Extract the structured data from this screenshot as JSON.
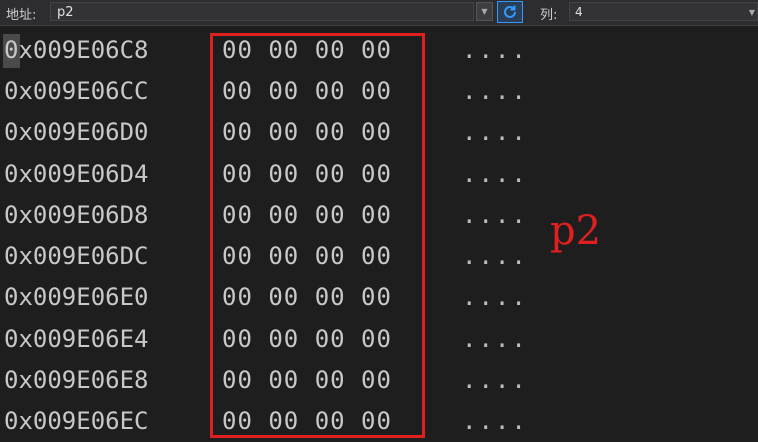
{
  "toolbar": {
    "address_label": "地址:",
    "address_value": "p2",
    "column_label": "列:",
    "column_value": "4"
  },
  "memory": {
    "rows": [
      {
        "address": "0x009E06C8",
        "bytes": "00 00 00 00",
        "ascii": "...."
      },
      {
        "address": "0x009E06CC",
        "bytes": "00 00 00 00",
        "ascii": "...."
      },
      {
        "address": "0x009E06D0",
        "bytes": "00 00 00 00",
        "ascii": "...."
      },
      {
        "address": "0x009E06D4",
        "bytes": "00 00 00 00",
        "ascii": "...."
      },
      {
        "address": "0x009E06D8",
        "bytes": "00 00 00 00",
        "ascii": "...."
      },
      {
        "address": "0x009E06DC",
        "bytes": "00 00 00 00",
        "ascii": "...."
      },
      {
        "address": "0x009E06E0",
        "bytes": "00 00 00 00",
        "ascii": "...."
      },
      {
        "address": "0x009E06E4",
        "bytes": "00 00 00 00",
        "ascii": "...."
      },
      {
        "address": "0x009E06E8",
        "bytes": "00 00 00 00",
        "ascii": "...."
      },
      {
        "address": "0x009E06EC",
        "bytes": "00 00 00 00",
        "ascii": "...."
      }
    ]
  },
  "annotation": {
    "text": "p2",
    "color": "#e02020"
  }
}
